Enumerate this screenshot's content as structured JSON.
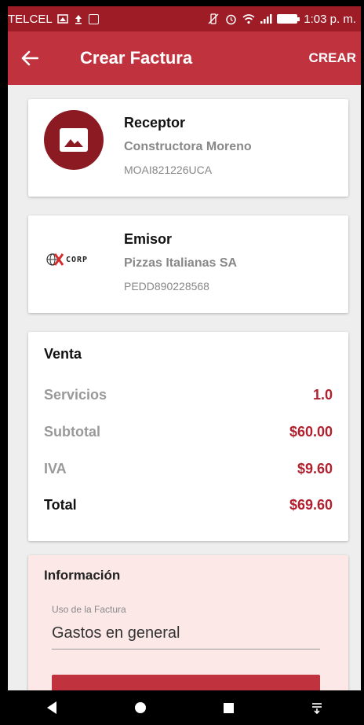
{
  "status_bar": {
    "carrier": "TELCEL",
    "time": "1:03 p. m."
  },
  "app_bar": {
    "title": "Crear Factura",
    "create_label": "CREAR",
    "back_icon": "arrow-left-icon"
  },
  "receptor": {
    "title": "Receptor",
    "name": "Constructora Moreno",
    "rfc": "MOAI821226UCA",
    "avatar_icon": "image-placeholder-icon"
  },
  "emisor": {
    "title": "Emisor",
    "name": "Pizzas Italianas SA",
    "rfc": "PEDD890228568",
    "logo_text": "CORP"
  },
  "venta": {
    "title": "Venta",
    "rows": [
      {
        "label": "Servicios",
        "value": "1.0"
      },
      {
        "label": "Subtotal",
        "value": "$60.00"
      },
      {
        "label": "IVA",
        "value": "$9.60"
      },
      {
        "label": "Total",
        "value": "$69.60"
      }
    ]
  },
  "informacion": {
    "title": "Información",
    "uso_label": "Uso de la Factura",
    "uso_value": "Gastos en general"
  },
  "colors": {
    "primary": "#c0323e",
    "primary_dark": "#9e1c26",
    "accent_value": "#b0202e",
    "info_bg": "#fde8e8"
  }
}
